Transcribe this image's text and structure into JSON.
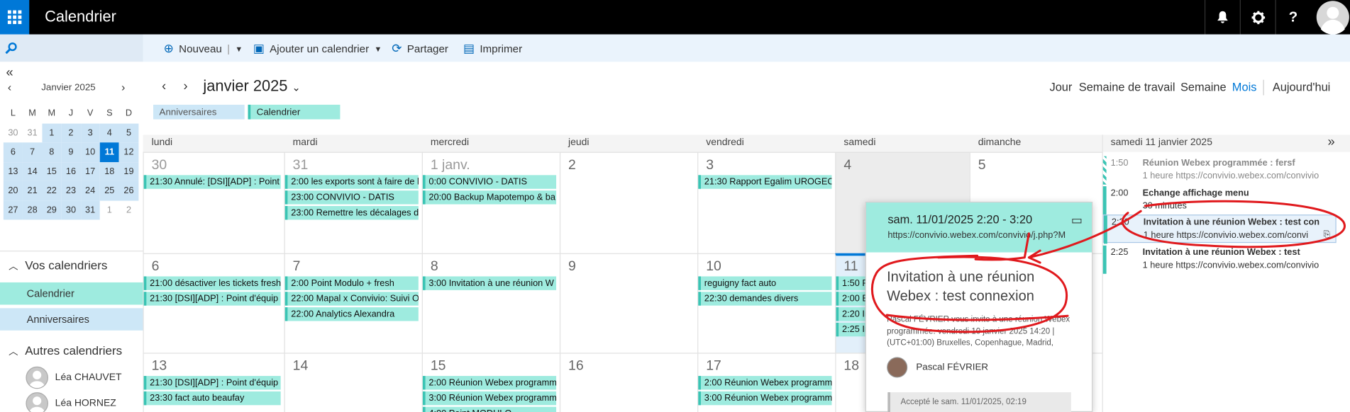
{
  "app": {
    "title": "Calendrier"
  },
  "commands": {
    "new": "Nouveau",
    "add_calendar": "Ajouter un calendrier",
    "share": "Partager",
    "print": "Imprimer"
  },
  "mini_calendar": {
    "title": "Janvier 2025",
    "days_of_week": [
      "L",
      "M",
      "M",
      "J",
      "V",
      "S",
      "D"
    ],
    "weeks": [
      [
        "30",
        "31",
        "1",
        "2",
        "3",
        "4",
        "5"
      ],
      [
        "6",
        "7",
        "8",
        "9",
        "10",
        "11",
        "12"
      ],
      [
        "13",
        "14",
        "15",
        "16",
        "17",
        "18",
        "19"
      ],
      [
        "20",
        "21",
        "22",
        "23",
        "24",
        "25",
        "26"
      ],
      [
        "27",
        "28",
        "29",
        "30",
        "31",
        "1",
        "2"
      ]
    ],
    "today": "11"
  },
  "sidebar": {
    "my_calendars_title": "Vos calendriers",
    "my_calendars": [
      "Calendrier",
      "Anniversaires"
    ],
    "other_calendars_title": "Autres calendriers",
    "people": [
      "Léa CHAUVET",
      "Léa HORNEZ"
    ]
  },
  "header": {
    "month_title": "janvier 2025",
    "views": [
      "Jour",
      "Semaine de travail",
      "Semaine",
      "Mois",
      "Aujourd'hui"
    ],
    "active_view": "Mois",
    "calendar_chips": [
      "Anniversaires",
      "Calendrier"
    ]
  },
  "colors": {
    "accent": "#0078d7",
    "event": "#9eebdf",
    "event_border": "#3bc4b4",
    "ink_annotation": "#e0191d"
  },
  "grid": {
    "days_of_week": [
      "lundi",
      "mardi",
      "mercredi",
      "jeudi",
      "vendredi",
      "samedi",
      "dimanche"
    ],
    "weeks": [
      {
        "days": [
          {
            "num": "30",
            "events": [
              "21:30 Annulé: [DSI][ADP] : Point"
            ]
          },
          {
            "num": "31",
            "events": [
              "2:00 les exports sont à faire de l",
              "23:00 CONVIVIO - DATIS",
              "23:00 Remettre les décalages de"
            ]
          },
          {
            "num": "1 janv.",
            "events": [
              "0:00 CONVIVIO - DATIS",
              "20:00 Backup Mapotempo & ba"
            ]
          },
          {
            "num": "2",
            "events": []
          },
          {
            "num": "3",
            "events": [
              "21:30 Rapport Egalim UROGEC"
            ]
          },
          {
            "num": "4",
            "events": []
          },
          {
            "num": "5",
            "events": []
          }
        ]
      },
      {
        "days": [
          {
            "num": "6",
            "events": [
              "21:00 désactiver les tickets fresh",
              "21:30 [DSI][ADP] : Point d'équip"
            ]
          },
          {
            "num": "7",
            "events": [
              "2:00 Point Modulo + fresh",
              "22:00 Mapal x Convivio: Suivi O",
              "22:00 Analytics Alexandra"
            ]
          },
          {
            "num": "8",
            "events": [
              "3:00 Invitation à une réunion W"
            ]
          },
          {
            "num": "9",
            "events": []
          },
          {
            "num": "10",
            "events": [
              "reguigny fact auto",
              "22:30 demandes divers"
            ]
          },
          {
            "num": "11",
            "events": [
              "1:50 Réu",
              "2:00 Ech",
              "2:20 Inv",
              "2:25 Inv"
            ]
          },
          {
            "num": "12",
            "events": []
          }
        ]
      },
      {
        "days": [
          {
            "num": "13",
            "events": [
              "21:30 [DSI][ADP] : Point d'équip",
              "23:30 fact auto beaufay"
            ]
          },
          {
            "num": "14",
            "events": []
          },
          {
            "num": "15",
            "events": [
              "2:00 Réunion Webex programm",
              "3:00 Réunion Webex programm",
              "4:00 Point MODULO"
            ]
          },
          {
            "num": "16",
            "events": []
          },
          {
            "num": "17",
            "events": [
              "2:00 Réunion Webex programm",
              "3:00 Réunion Webex programm"
            ]
          },
          {
            "num": "18",
            "events": []
          },
          {
            "num": "19",
            "events": []
          }
        ]
      }
    ]
  },
  "agenda": {
    "title": "samedi 11 janvier 2025",
    "items": [
      {
        "time": "1:50",
        "title": "Réunion Webex programmée : fersf",
        "detail": "1 heure   https://convivio.webex.com/convivio"
      },
      {
        "time": "2:00",
        "title": "Echange affichage menu",
        "detail": "30 minutes"
      },
      {
        "time": "2:20",
        "title": "Invitation à une réunion Webex : test connex",
        "detail": "1 heure   https://convivio.webex.com/convi"
      },
      {
        "time": "2:25",
        "title": "Invitation à une réunion Webex : test",
        "detail": "1 heure   https://convivio.webex.com/convivio"
      }
    ]
  },
  "popup": {
    "datetime": "sam. 11/01/2025 2:20 - 3:20",
    "url": "https://convivio.webex.com/convivio/j.php?M",
    "title": "Invitation à une réunion Webex : test connexion",
    "body": "Pascal FÉVRIER vous invite à une réunion Webex programmée. vendredi 10 janvier 2025 14:20 | (UTC+01:00) Bruxelles, Copenhague, Madrid,",
    "organizer": "Pascal FÉVRIER",
    "status": "Accepté le sam. 11/01/2025, 02:19"
  }
}
